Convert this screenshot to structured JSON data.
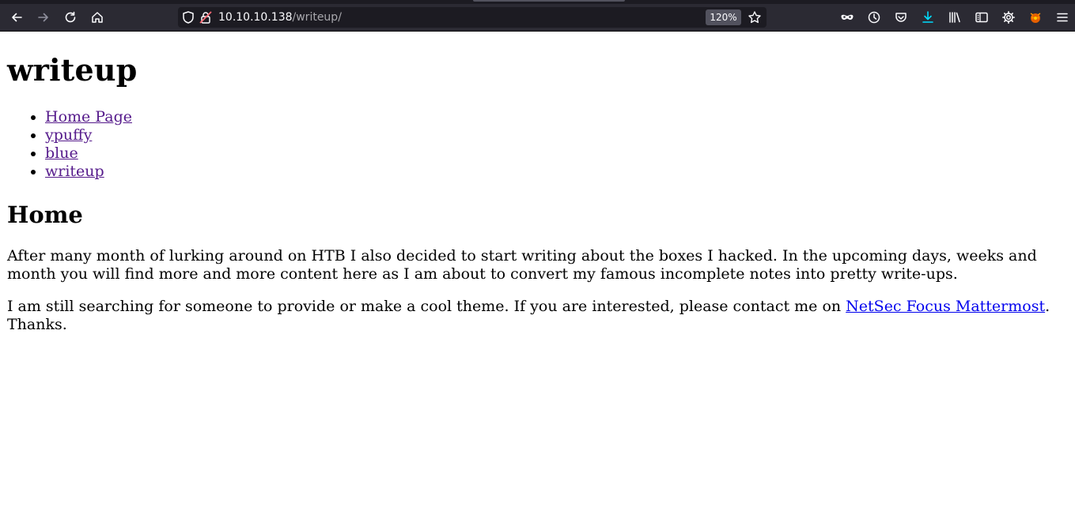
{
  "browser": {
    "url_host": "10.10.10.138",
    "url_path": "/writeup/",
    "zoom": "120%",
    "icons": [
      "back-icon",
      "forward-icon",
      "reload-icon",
      "home-icon",
      "shield-icon",
      "lock-icon",
      "bookmark-star-icon",
      "private-mask-icon",
      "history-icon",
      "pocket-icon",
      "downloads-icon",
      "library-icon",
      "sidebar-icon",
      "settings-icon",
      "extension-icon",
      "menu-icon"
    ],
    "colors": {
      "toolbar": "#2b2a33",
      "urlbar": "#1c1b22",
      "download_accent": "#00ddff"
    }
  },
  "page": {
    "title": "writeup",
    "nav": [
      {
        "label": "Home Page"
      },
      {
        "label": "ypuffy"
      },
      {
        "label": "blue"
      },
      {
        "label": "writeup"
      }
    ],
    "section_title": "Home",
    "paragraph1": "After many month of lurking around on HTB I also decided to start writing about the boxes I hacked. In the upcoming days, weeks and month you will find more and more content here as I am about to convert my famous incomplete notes into pretty write-ups.",
    "paragraph2_before": "I am still searching for someone to provide or make a cool theme. If you are interested, please contact me on ",
    "paragraph2_link": "NetSec Focus Mattermost",
    "paragraph2_after": ". Thanks."
  }
}
